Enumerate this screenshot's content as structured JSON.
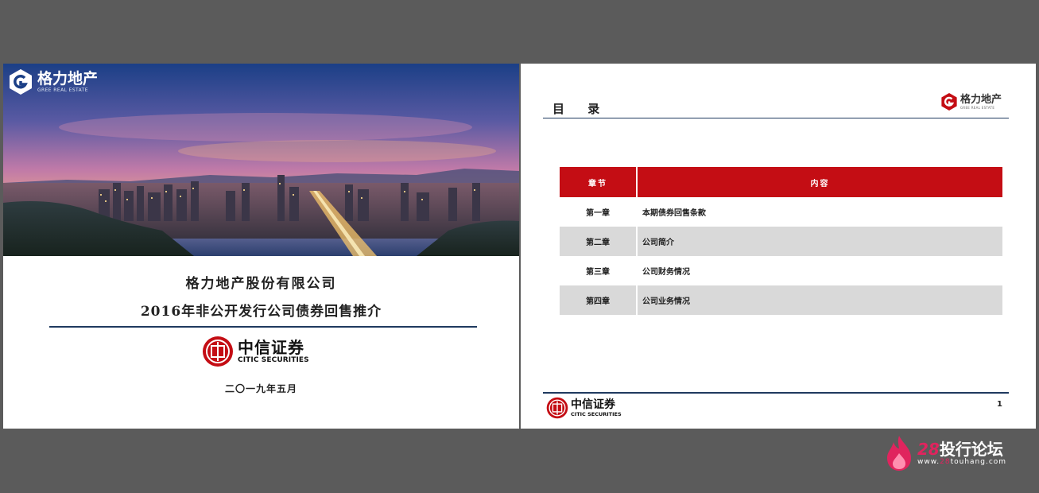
{
  "cover": {
    "brand": {
      "name_cn": "格力地产",
      "name_en": "GREE REAL ESTATE"
    },
    "company": "格力地产股份有限公司",
    "title": "2016年非公开发行公司债券回售推介",
    "underwriter": {
      "name_cn": "中信证券",
      "name_en": "CITIC SECURITIES"
    },
    "date": "二〇一九年五月"
  },
  "toc_slide": {
    "heading": "目 录",
    "brand": {
      "name_cn": "格力地产",
      "name_en": "GREE REAL ESTATE"
    },
    "table": {
      "headers": [
        "章节",
        "内容"
      ],
      "rows": [
        {
          "chapter": "第一章",
          "content": "本期债券回售条款",
          "shaded": false
        },
        {
          "chapter": "第二章",
          "content": "公司简介",
          "shaded": true
        },
        {
          "chapter": "第三章",
          "content": "公司财务情况",
          "shaded": false
        },
        {
          "chapter": "第四章",
          "content": "公司业务情况",
          "shaded": true
        }
      ]
    },
    "footer_brand": {
      "name_cn": "中信证券",
      "name_en": "CITIC SECURITIES"
    },
    "page_number": "1"
  },
  "watermark": {
    "number": "28",
    "name": "投行论坛",
    "url_prefix": "www.",
    "url_highlight": "28",
    "url_suffix": "touhang.com"
  },
  "colors": {
    "accent_red": "#c40d14",
    "navy_rule": "#1f3a5f",
    "shade_gray": "#d9d9d9",
    "backdrop": "#5b5b5b"
  }
}
